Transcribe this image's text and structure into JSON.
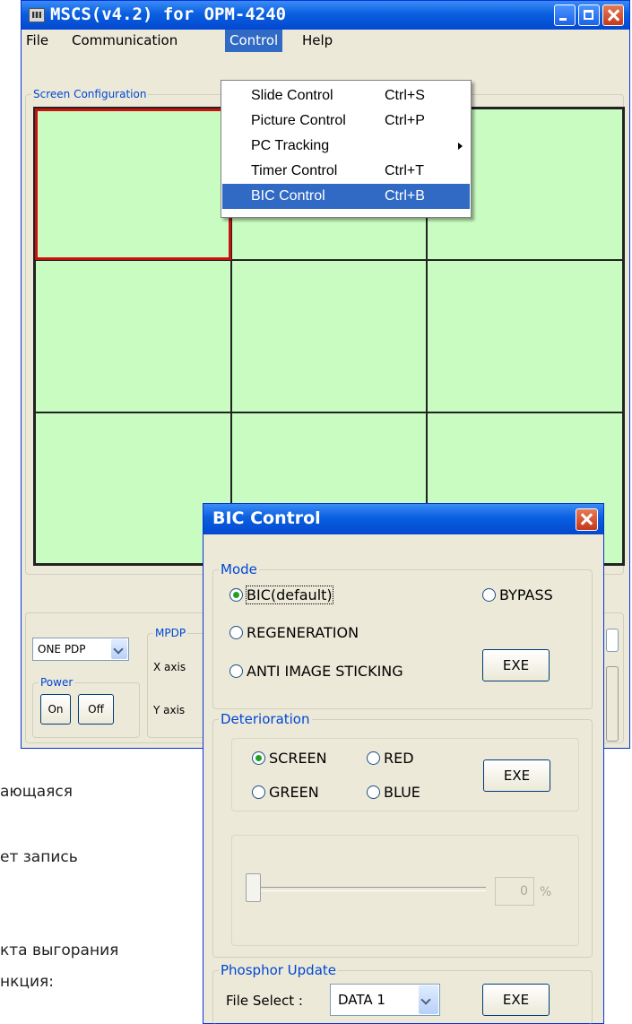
{
  "window": {
    "title": "MSCS(v4.2) for OPM-4240"
  },
  "menu": [
    {
      "label": "File"
    },
    {
      "label": "Communication"
    },
    {
      "label": "Control"
    },
    {
      "label": "Help"
    }
  ],
  "control_menu": [
    {
      "label": "Slide Control",
      "shortcut": "Ctrl+S"
    },
    {
      "label": "Picture Control",
      "shortcut": "Ctrl+P"
    },
    {
      "label": "PC Tracking",
      "shortcut": "",
      "submenu": true
    },
    {
      "label": "Timer Control",
      "shortcut": "Ctrl+T"
    },
    {
      "label": "BIC Control",
      "shortcut": "Ctrl+B"
    }
  ],
  "screen_config": {
    "legend": "Screen Configuration",
    "selected_cell": 1
  },
  "bottom": {
    "pdp_select": "ONE PDP",
    "power_legend": "Power",
    "on_label": "On",
    "off_label": "Off",
    "mpdp_legend": "MPDP",
    "x_axis": "X axis",
    "y_axis": "Y axis"
  },
  "background_text": [
    "ающаяся",
    "ет запись",
    "кта выгорания",
    "нкция:"
  ],
  "bic_dialog": {
    "title": "BIC Control",
    "mode": {
      "legend": "Mode",
      "options": [
        "BIC(default)",
        "BYPASS",
        "REGENERATION",
        "ANTI IMAGE STICKING"
      ],
      "selected": "BIC(default)",
      "exe_label": "EXE"
    },
    "deterioration": {
      "legend": "Deterioration",
      "options": [
        "SCREEN",
        "RED",
        "GREEN",
        "BLUE"
      ],
      "selected": "SCREEN",
      "exe_label": "EXE",
      "slider_value": 0,
      "value_text": "0",
      "unit": "%"
    },
    "phosphor": {
      "legend": "Phosphor Update",
      "file_select_label": "File Select :",
      "file_value": "DATA 1",
      "exe_label": "EXE"
    }
  },
  "colors": {
    "titlebar": "#0a5fe0",
    "cell": "#c8fcc0",
    "selected_border": "#cc1010",
    "menu_highlight": "#316ac5"
  }
}
